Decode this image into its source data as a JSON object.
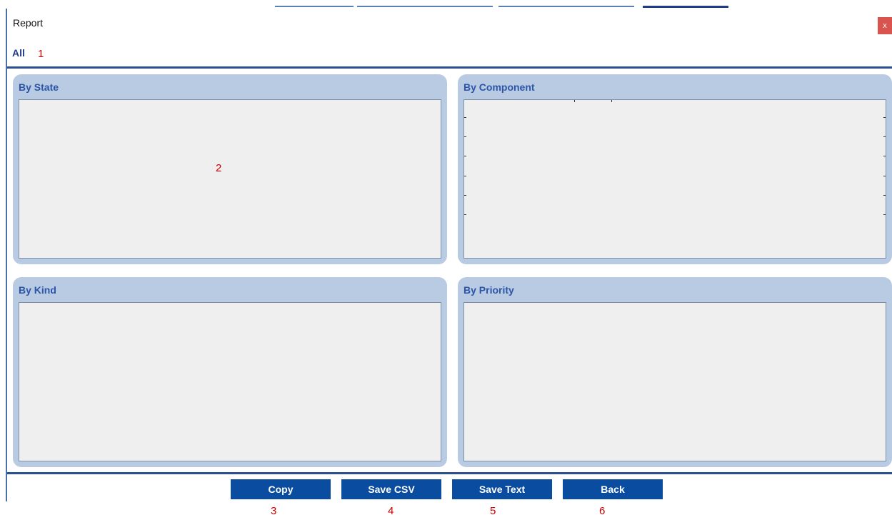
{
  "window": {
    "title": "Report",
    "close_label": "x"
  },
  "tabs": [
    {
      "label": "All"
    }
  ],
  "panels": [
    {
      "title": "By State"
    },
    {
      "title": "By Component"
    },
    {
      "title": "By Kind"
    },
    {
      "title": "By Priority"
    }
  ],
  "buttons": [
    {
      "label": "Copy"
    },
    {
      "label": "Save CSV"
    },
    {
      "label": "Save Text"
    },
    {
      "label": "Back"
    }
  ],
  "annotations": [
    "1",
    "2",
    "3",
    "4",
    "5",
    "6"
  ],
  "colors": {
    "panel_header": "#b9cbe3",
    "panel_title": "#2c55a8",
    "button": "#0a4da0",
    "annotation": "#cc0000",
    "close": "#d9534f"
  }
}
